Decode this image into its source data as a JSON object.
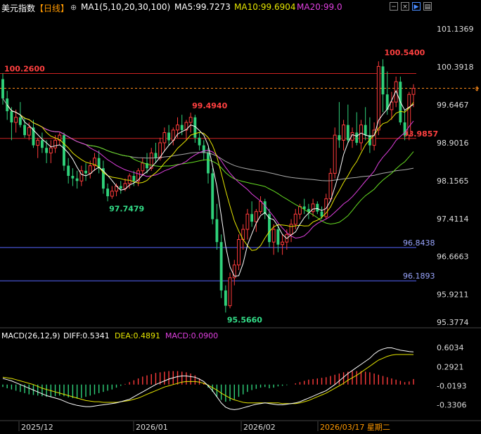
{
  "header": {
    "title": "美元指数",
    "period": "【日线】",
    "ma_label": "MA1(5,10,20,30,100)",
    "ma5": "MA5:99.7273",
    "ma10": "MA10:99.6904",
    "ma20": "MA20:99.0"
  },
  "macd_header": {
    "label": "MACD(26,12,9)",
    "diff": "DIFF:0.5341",
    "dea": "DEA:0.4891",
    "macd": "MACD:0.0900"
  },
  "colors": {
    "up": "#ff3b3b",
    "down": "#2fd17a",
    "ma5": "#ffffff",
    "ma10": "#e6e600",
    "ma20": "#e040e0",
    "ma30": "#66dd22",
    "ma100": "#aaaaaa",
    "level_red": "#cc2222",
    "level_blue": "#5566ff"
  },
  "chart_data": [
    {
      "type": "candlestick",
      "name": "main",
      "y_ticks": [
        "101.1369",
        "100.3918",
        "99.6467",
        "98.9016",
        "98.1565",
        "97.4114",
        "96.6663",
        "95.9211",
        "95.3774"
      ],
      "ylim": [
        95.3774,
        101.4
      ],
      "x_labels": [
        "2025/12",
        "2026/01",
        "2026/02",
        "2026/03/17 星期二"
      ],
      "level_lines": [
        {
          "value": 100.26,
          "label": "100.2600",
          "color": "red"
        },
        {
          "value": 98.9857,
          "label": "98.9857",
          "color": "red"
        },
        {
          "value": 96.8438,
          "label": "96.8438",
          "color": "blue"
        },
        {
          "value": 96.1893,
          "label": "96.1893",
          "color": "blue"
        }
      ],
      "current_price": 99.97,
      "annotations": [
        {
          "label": "100.5400",
          "value": 100.54
        },
        {
          "label": "99.4940",
          "value": 99.494
        },
        {
          "label": "97.7479",
          "value": 97.7479
        },
        {
          "label": "95.5660",
          "value": 95.566
        }
      ],
      "candles": [
        [
          100.15,
          100.26,
          99.65,
          99.77
        ],
        [
          99.77,
          99.92,
          99.35,
          99.52
        ],
        [
          99.52,
          99.6,
          98.95,
          99.3
        ],
        [
          99.3,
          99.55,
          99.1,
          99.4
        ],
        [
          99.4,
          99.7,
          99.2,
          99.25
        ],
        [
          99.25,
          99.4,
          99.0,
          99.05
        ],
        [
          99.05,
          99.3,
          98.95,
          99.2
        ],
        [
          99.2,
          99.35,
          98.8,
          98.85
        ],
        [
          98.85,
          99.0,
          98.6,
          98.95
        ],
        [
          98.95,
          99.1,
          98.7,
          98.8
        ],
        [
          98.8,
          98.95,
          98.5,
          98.7
        ],
        [
          98.7,
          98.95,
          98.5,
          98.8
        ],
        [
          98.8,
          99.05,
          98.7,
          98.95
        ],
        [
          98.95,
          99.1,
          98.85,
          99.05
        ],
        [
          99.05,
          99.1,
          98.35,
          98.45
        ],
        [
          98.45,
          98.6,
          98.1,
          98.25
        ],
        [
          98.25,
          98.4,
          98.05,
          98.2
        ],
        [
          98.2,
          98.35,
          98.0,
          98.15
        ],
        [
          98.15,
          98.45,
          98.05,
          98.35
        ],
        [
          98.35,
          98.5,
          98.15,
          98.3
        ],
        [
          98.3,
          98.55,
          98.2,
          98.45
        ],
        [
          98.45,
          98.7,
          98.35,
          98.6
        ],
        [
          98.6,
          98.75,
          98.3,
          98.4
        ],
        [
          98.4,
          98.55,
          97.9,
          98.0
        ],
        [
          98.0,
          98.1,
          97.75,
          97.85
        ],
        [
          97.85,
          98.05,
          97.8,
          97.95
        ],
        [
          97.95,
          98.1,
          97.85,
          98.05
        ],
        [
          98.05,
          98.15,
          97.9,
          98.0
        ],
        [
          98.0,
          98.2,
          97.95,
          98.1
        ],
        [
          98.1,
          98.3,
          98.0,
          98.25
        ],
        [
          98.25,
          98.35,
          98.05,
          98.15
        ],
        [
          98.15,
          98.4,
          98.05,
          98.35
        ],
        [
          98.35,
          98.6,
          98.25,
          98.5
        ],
        [
          98.5,
          98.7,
          98.3,
          98.4
        ],
        [
          98.4,
          98.8,
          98.35,
          98.7
        ],
        [
          98.7,
          98.9,
          98.5,
          98.6
        ],
        [
          98.6,
          99.0,
          98.55,
          98.9
        ],
        [
          98.9,
          99.2,
          98.75,
          99.1
        ],
        [
          99.1,
          99.25,
          98.85,
          98.95
        ],
        [
          98.95,
          99.2,
          98.85,
          99.15
        ],
        [
          99.15,
          99.4,
          99.0,
          99.25
        ],
        [
          99.25,
          99.45,
          99.05,
          99.15
        ],
        [
          99.15,
          99.35,
          98.95,
          99.3
        ],
        [
          99.3,
          99.49,
          99.1,
          99.4
        ],
        [
          99.4,
          99.45,
          98.9,
          99.0
        ],
        [
          99.0,
          99.1,
          98.75,
          98.85
        ],
        [
          98.85,
          98.95,
          98.55,
          98.7
        ],
        [
          98.7,
          98.8,
          98.1,
          98.3
        ],
        [
          98.3,
          98.4,
          97.3,
          97.4
        ],
        [
          97.4,
          97.7,
          96.8,
          96.95
        ],
        [
          96.95,
          97.1,
          95.85,
          96.0
        ],
        [
          96.0,
          96.1,
          95.566,
          95.7
        ],
        [
          95.7,
          96.35,
          95.65,
          96.25
        ],
        [
          96.25,
          96.6,
          96.1,
          96.5
        ],
        [
          96.5,
          97.1,
          96.4,
          97.0
        ],
        [
          97.0,
          97.3,
          96.8,
          97.2
        ],
        [
          97.2,
          97.6,
          97.0,
          97.5
        ],
        [
          97.5,
          97.75,
          97.25,
          97.35
        ],
        [
          97.35,
          97.6,
          97.15,
          97.55
        ],
        [
          97.55,
          97.85,
          97.5,
          97.75
        ],
        [
          97.75,
          97.8,
          97.4,
          97.5
        ],
        [
          97.5,
          97.6,
          96.85,
          96.95
        ],
        [
          96.95,
          97.3,
          96.7,
          97.2
        ],
        [
          97.2,
          97.3,
          96.75,
          96.9
        ],
        [
          96.9,
          97.1,
          96.7,
          96.95
        ],
        [
          96.95,
          97.2,
          96.8,
          97.1
        ],
        [
          97.1,
          97.4,
          96.95,
          97.3
        ],
        [
          97.3,
          97.6,
          97.2,
          97.5
        ],
        [
          97.5,
          97.7,
          97.4,
          97.65
        ],
        [
          97.65,
          97.8,
          97.5,
          97.6
        ],
        [
          97.6,
          97.7,
          97.4,
          97.55
        ],
        [
          97.55,
          97.8,
          97.45,
          97.7
        ],
        [
          97.7,
          97.75,
          97.5,
          97.55
        ],
        [
          97.55,
          97.65,
          97.4,
          97.45
        ],
        [
          97.45,
          97.9,
          97.4,
          97.8
        ],
        [
          97.8,
          98.4,
          97.75,
          98.3
        ],
        [
          98.3,
          99.2,
          98.2,
          99.05
        ],
        [
          99.05,
          99.7,
          98.8,
          98.95
        ],
        [
          98.95,
          99.35,
          98.75,
          99.25
        ],
        [
          99.25,
          99.65,
          98.9,
          98.95
        ],
        [
          98.95,
          99.2,
          98.8,
          99.1
        ],
        [
          99.1,
          99.5,
          98.85,
          98.9
        ],
        [
          98.9,
          99.35,
          98.75,
          99.25
        ],
        [
          99.25,
          99.6,
          98.95,
          99.05
        ],
        [
          99.05,
          99.4,
          98.7,
          98.85
        ],
        [
          98.85,
          99.3,
          98.75,
          99.15
        ],
        [
          99.15,
          100.5,
          99.05,
          100.4
        ],
        [
          100.4,
          100.54,
          99.5,
          99.85
        ],
        [
          99.85,
          100.3,
          99.45,
          99.55
        ],
        [
          99.55,
          99.9,
          99.35,
          99.7
        ],
        [
          99.7,
          100.2,
          99.6,
          100.1
        ],
        [
          100.1,
          100.2,
          99.25,
          99.3
        ],
        [
          99.3,
          99.55,
          98.95,
          99.05
        ],
        [
          99.05,
          99.9,
          98.95,
          99.85
        ],
        [
          99.85,
          100.05,
          99.6,
          99.97
        ]
      ]
    },
    {
      "type": "macd",
      "name": "macd",
      "y_ticks": [
        "0.6034",
        "0.2921",
        "-0.0193",
        "-0.3306"
      ],
      "ylim": [
        -0.52,
        0.72
      ],
      "hist": [
        -0.04,
        -0.06,
        -0.08,
        -0.1,
        -0.12,
        -0.14,
        -0.16,
        -0.17,
        -0.18,
        -0.19,
        -0.2,
        -0.2,
        -0.19,
        -0.18,
        -0.19,
        -0.21,
        -0.22,
        -0.23,
        -0.22,
        -0.2,
        -0.18,
        -0.16,
        -0.14,
        -0.12,
        -0.1,
        -0.08,
        -0.05,
        -0.02,
        0.01,
        0.04,
        0.07,
        0.1,
        0.13,
        0.15,
        0.17,
        0.19,
        0.2,
        0.21,
        0.22,
        0.22,
        0.22,
        0.21,
        0.2,
        0.18,
        0.15,
        0.1,
        0.03,
        -0.05,
        -0.12,
        -0.2,
        -0.25,
        -0.28,
        -0.27,
        -0.24,
        -0.2,
        -0.16,
        -0.12,
        -0.09,
        -0.07,
        -0.05,
        -0.04,
        -0.06,
        -0.05,
        -0.03,
        -0.02,
        -0.01,
        0.0,
        0.02,
        0.04,
        0.06,
        0.08,
        0.09,
        0.1,
        0.11,
        0.12,
        0.14,
        0.16,
        0.18,
        0.2,
        0.21,
        0.22,
        0.22,
        0.22,
        0.21,
        0.2,
        0.18,
        0.16,
        0.14,
        0.12,
        0.1,
        0.08,
        0.06,
        0.04,
        0.05,
        0.09
      ],
      "diff": [
        0.1,
        0.08,
        0.06,
        0.03,
        0.0,
        -0.03,
        -0.06,
        -0.09,
        -0.12,
        -0.15,
        -0.18,
        -0.2,
        -0.22,
        -0.24,
        -0.27,
        -0.3,
        -0.32,
        -0.34,
        -0.35,
        -0.36,
        -0.36,
        -0.35,
        -0.34,
        -0.33,
        -0.32,
        -0.31,
        -0.3,
        -0.28,
        -0.26,
        -0.24,
        -0.2,
        -0.16,
        -0.12,
        -0.08,
        -0.04,
        0.0,
        0.03,
        0.06,
        0.09,
        0.11,
        0.13,
        0.14,
        0.14,
        0.13,
        0.12,
        0.09,
        0.05,
        -0.02,
        -0.1,
        -0.2,
        -0.3,
        -0.37,
        -0.4,
        -0.41,
        -0.4,
        -0.38,
        -0.36,
        -0.34,
        -0.32,
        -0.31,
        -0.3,
        -0.31,
        -0.32,
        -0.33,
        -0.33,
        -0.32,
        -0.31,
        -0.3,
        -0.28,
        -0.25,
        -0.22,
        -0.19,
        -0.16,
        -0.13,
        -0.1,
        -0.05,
        0.0,
        0.06,
        0.12,
        0.18,
        0.23,
        0.28,
        0.33,
        0.38,
        0.43,
        0.5,
        0.55,
        0.58,
        0.6,
        0.6,
        0.58,
        0.56,
        0.55,
        0.54,
        0.5341
      ],
      "dea": [
        0.12,
        0.11,
        0.1,
        0.08,
        0.06,
        0.04,
        0.02,
        0.0,
        -0.03,
        -0.06,
        -0.08,
        -0.1,
        -0.12,
        -0.14,
        -0.16,
        -0.18,
        -0.2,
        -0.22,
        -0.24,
        -0.26,
        -0.27,
        -0.28,
        -0.28,
        -0.29,
        -0.29,
        -0.29,
        -0.29,
        -0.28,
        -0.27,
        -0.26,
        -0.24,
        -0.22,
        -0.19,
        -0.16,
        -0.13,
        -0.1,
        -0.07,
        -0.04,
        -0.02,
        0.0,
        0.02,
        0.04,
        0.05,
        0.05,
        0.05,
        0.04,
        0.02,
        -0.01,
        -0.05,
        -0.09,
        -0.14,
        -0.18,
        -0.22,
        -0.25,
        -0.27,
        -0.29,
        -0.3,
        -0.3,
        -0.3,
        -0.3,
        -0.3,
        -0.3,
        -0.3,
        -0.3,
        -0.31,
        -0.31,
        -0.31,
        -0.31,
        -0.3,
        -0.28,
        -0.26,
        -0.23,
        -0.2,
        -0.17,
        -0.14,
        -0.1,
        -0.06,
        -0.02,
        0.02,
        0.07,
        0.11,
        0.15,
        0.2,
        0.25,
        0.3,
        0.35,
        0.4,
        0.43,
        0.46,
        0.48,
        0.49,
        0.49,
        0.49,
        0.49,
        0.4891
      ]
    }
  ]
}
